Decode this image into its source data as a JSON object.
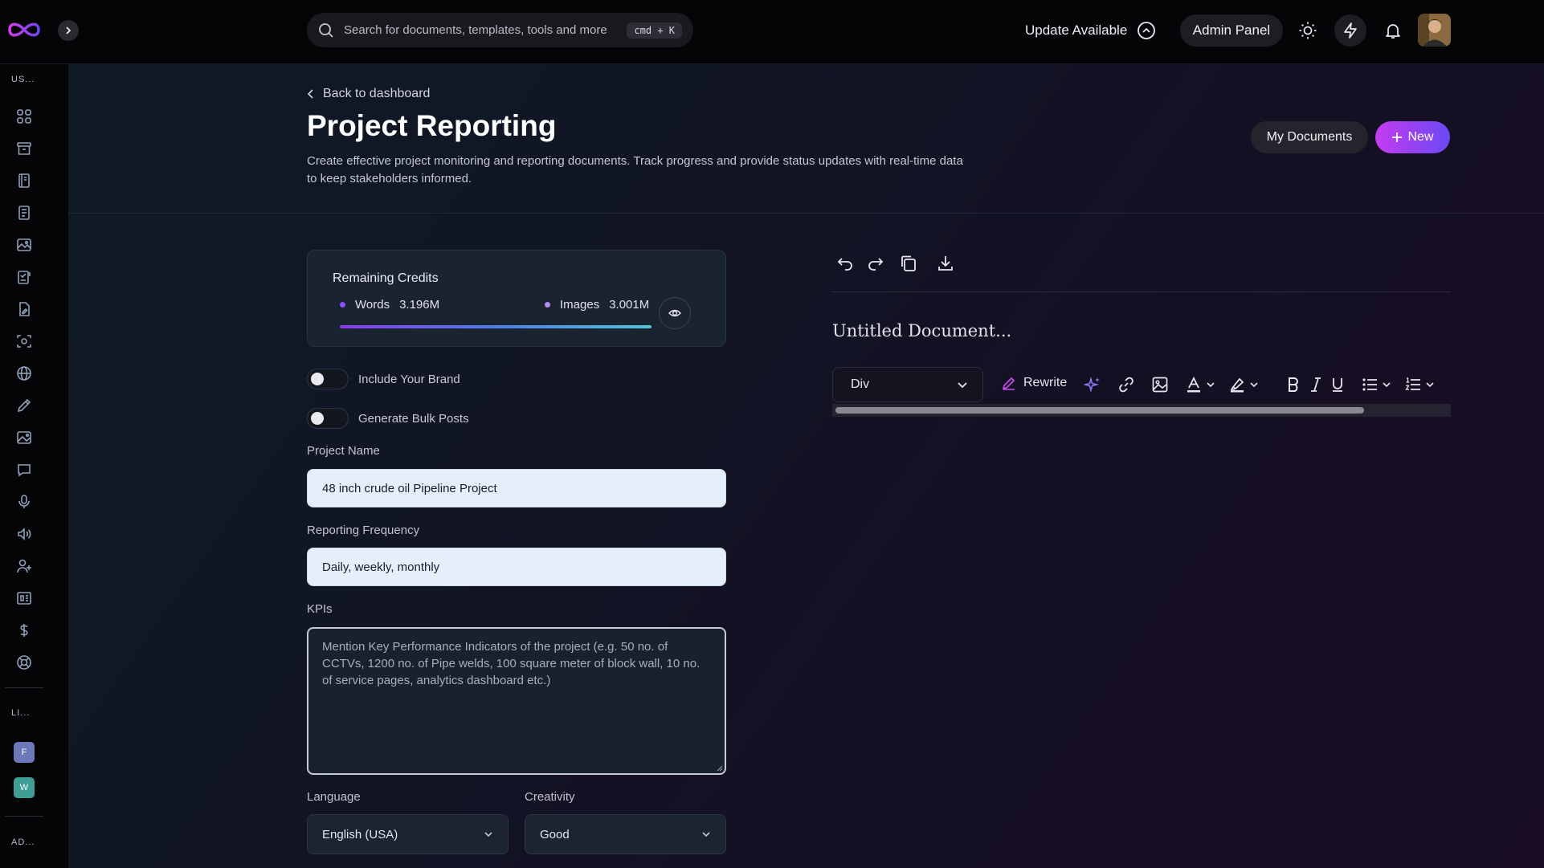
{
  "topbar": {
    "search_placeholder": "Search for documents, templates, tools and more",
    "shortcut": "cmd + K",
    "update_label": "Update Available",
    "admin_label": "Admin Panel"
  },
  "sidebar": {
    "section_user": "US...",
    "section_links": "LI...",
    "section_admin": "AD...",
    "workspaces": [
      {
        "letter": "F",
        "color": "#6b79b8"
      },
      {
        "letter": "W",
        "color": "#3f9e96"
      }
    ]
  },
  "page": {
    "back_label": "Back to dashboard",
    "title": "Project Reporting",
    "description": "Create effective project monitoring and reporting documents. Track progress and provide status updates with real-time data to keep stakeholders informed.",
    "my_documents_label": "My Documents",
    "new_label": "New"
  },
  "credits": {
    "title": "Remaining Credits",
    "words_label": "Words",
    "words_value": "3.196M",
    "images_label": "Images",
    "images_value": "3.001M",
    "words_color": "#8b4dff",
    "images_color": "#b38cf0",
    "fill_fraction": 1.0
  },
  "form": {
    "toggle_brand": "Include Your Brand",
    "toggle_bulk": "Generate Bulk Posts",
    "project_name_label": "Project Name",
    "project_name_value": "48 inch crude oil Pipeline Project",
    "frequency_label": "Reporting Frequency",
    "frequency_value": "Daily, weekly, monthly",
    "kpis_label": "KPIs",
    "kpis_placeholder": "Mention Key Performance Indicators of the project (e.g. 50 no. of CCTVs, 1200 no. of Pipe welds, 100 square meter of block wall, 10 no. of service pages, analytics dashboard etc.)",
    "language_label": "Language",
    "language_value": "English (USA)",
    "creativity_label": "Creativity",
    "creativity_value": "Good"
  },
  "editor": {
    "doc_title": "Untitled Document...",
    "block_type": "Div",
    "rewrite_label": "Rewrite"
  },
  "colors": {
    "accent_gradient_start": "#c43cf0",
    "accent_gradient_end": "#6b49f3"
  }
}
